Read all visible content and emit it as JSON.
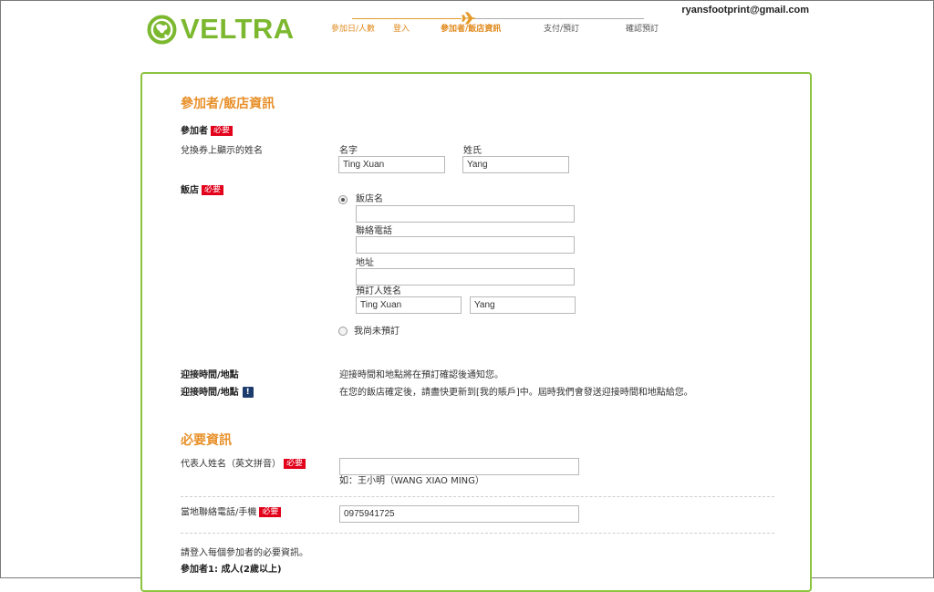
{
  "header": {
    "logo_text": "VELTRA",
    "user_email": "ryansfootprint@gmail.com",
    "steps": [
      {
        "label": "參加日/人數",
        "state": "done"
      },
      {
        "label": "登入",
        "state": "done"
      },
      {
        "label": "參加者/飯店資訊",
        "state": "current"
      },
      {
        "label": "支付/預訂",
        "state": "todo"
      },
      {
        "label": "確認預訂",
        "state": "todo"
      }
    ]
  },
  "participant_section": {
    "title": "參加者/飯店資訊",
    "participant_label": "參加者",
    "required_tag": "必要",
    "voucher_name_label": "兌換券上顯示的姓名",
    "first_name_label": "名字",
    "last_name_label": "姓氏",
    "first_name_value": "Ting Xuan",
    "last_name_value": "Yang"
  },
  "hotel_section": {
    "hotel_label": "飯店",
    "required_tag": "必要",
    "option_booked": {
      "hotel_name_label": "飯店名",
      "hotel_name_value": "",
      "phone_label": "聯絡電話",
      "phone_value": "",
      "address_label": "地址",
      "address_value": "",
      "booker_label": "預訂人姓名",
      "booker_first_value": "Ting Xuan",
      "booker_last_value": "Yang"
    },
    "option_not_booked_label": "我尚未預訂",
    "selected_option": "booked"
  },
  "pickup": {
    "label_1": "迎接時間/地點",
    "text_1": "迎接時間和地點將在預訂確認後通知您。",
    "label_2": "迎接時間/地點",
    "info_icon_glyph": "!",
    "text_2": "在您的飯店確定後，請盡快更新到[我的賬戶]中。屆時我們會發送迎接時間和地點給您。"
  },
  "required_info": {
    "title": "必要資訊",
    "required_tag": "必要",
    "rep_name_label": "代表人姓名（英文拼音）",
    "rep_name_value": "",
    "rep_name_hint": "如：王小明（WANG XIAO MING）",
    "local_phone_label": "當地聯絡電話/手機",
    "local_phone_value": "0975941725",
    "login_note": "請登入每個參加者的必要資訊。",
    "participant_1_label": "參加者1: 成人(2歲以上)"
  },
  "colors": {
    "brand_green": "#7cb82f",
    "panel_border": "#8cc43f",
    "accent_orange": "#e8902a",
    "required_red": "#e2001a",
    "info_navy": "#1d3c6e"
  }
}
